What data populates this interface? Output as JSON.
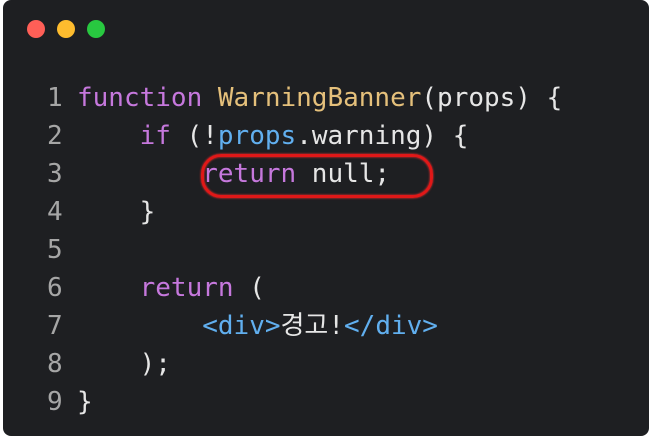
{
  "window": {
    "controls": [
      {
        "name": "close",
        "color": "#ff5f57"
      },
      {
        "name": "minimize",
        "color": "#febc2e"
      },
      {
        "name": "maximize",
        "color": "#28c840"
      }
    ]
  },
  "code": {
    "lines": [
      {
        "num": "1",
        "tokens": [
          {
            "t": "function",
            "c": "kw"
          },
          {
            "t": " ",
            "c": "plain"
          },
          {
            "t": "WarningBanner",
            "c": "fn"
          },
          {
            "t": "(props) {",
            "c": "plain"
          }
        ]
      },
      {
        "num": "2",
        "tokens": [
          {
            "t": "    ",
            "c": "plain"
          },
          {
            "t": "if",
            "c": "kw"
          },
          {
            "t": " (!",
            "c": "plain"
          },
          {
            "t": "props",
            "c": "prop"
          },
          {
            "t": ".warning) {",
            "c": "plain"
          }
        ]
      },
      {
        "num": "3",
        "tokens": [
          {
            "t": "        ",
            "c": "plain"
          },
          {
            "t": "return",
            "c": "kw"
          },
          {
            "t": " null;",
            "c": "plain"
          }
        ]
      },
      {
        "num": "4",
        "tokens": [
          {
            "t": "    }",
            "c": "plain"
          }
        ]
      },
      {
        "num": "5",
        "tokens": []
      },
      {
        "num": "6",
        "tokens": [
          {
            "t": "    ",
            "c": "plain"
          },
          {
            "t": "return",
            "c": "kw"
          },
          {
            "t": " (",
            "c": "plain"
          }
        ]
      },
      {
        "num": "7",
        "tokens": [
          {
            "t": "        ",
            "c": "plain"
          },
          {
            "t": "<div>",
            "c": "tag"
          },
          {
            "t": "경고!",
            "c": "plain"
          },
          {
            "t": "</div>",
            "c": "tag"
          }
        ]
      },
      {
        "num": "8",
        "tokens": [
          {
            "t": "    );",
            "c": "plain"
          }
        ]
      },
      {
        "num": "9",
        "tokens": [
          {
            "t": "}",
            "c": "plain"
          }
        ]
      }
    ]
  },
  "annotation": {
    "highlight_color": "#e01818",
    "highlighted_line": "3"
  }
}
